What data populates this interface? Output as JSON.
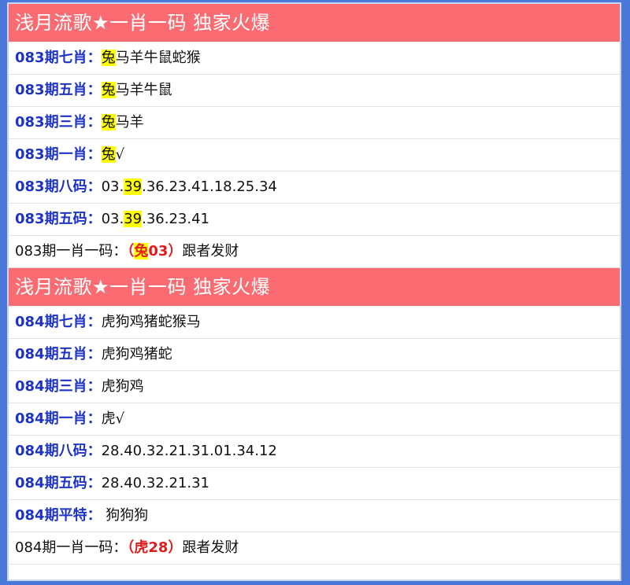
{
  "colors": {
    "header_bg": "#fa6b72",
    "label_blue": "#1d33c6",
    "highlight": "#ffff00",
    "red": "#e11b1b"
  },
  "blocks": [
    {
      "title": "浅月流歌★一肖一码 独家火爆",
      "rows": [
        {
          "label": "083期七肖：",
          "hl": "兔",
          "rest": "马羊牛鼠蛇猴"
        },
        {
          "label": "083期五肖：",
          "hl": "兔",
          "rest": "马羊牛鼠"
        },
        {
          "label": "083期三肖：",
          "hl": "兔",
          "rest": "马羊"
        },
        {
          "label": "083期一肖：",
          "hl": "兔",
          "rest": "√"
        },
        {
          "label": "083期八码：",
          "pre": "03.",
          "hl": "39",
          "rest": ".36.23.41.18.25.34"
        },
        {
          "label": "083期五码：",
          "pre": "03.",
          "hl": "39",
          "rest": ".36.23.41"
        }
      ],
      "final": {
        "label": "083期一肖一码：",
        "open": "（",
        "hl": "兔",
        "num": "03",
        "close": "）",
        "tail": "跟者发财"
      }
    },
    {
      "title": "浅月流歌★一肖一码 独家火爆",
      "rows": [
        {
          "label": "084期七肖：",
          "value": "虎狗鸡猪蛇猴马"
        },
        {
          "label": "084期五肖：",
          "value": "虎狗鸡猪蛇"
        },
        {
          "label": "084期三肖：",
          "value": "虎狗鸡"
        },
        {
          "label": "084期一肖：",
          "value": "虎√"
        },
        {
          "label": "084期八码：",
          "value": "28.40.32.21.31.01.34.12"
        },
        {
          "label": "084期五码：",
          "value": "28.40.32.21.31"
        },
        {
          "label": "084期平特：",
          "value": " 狗狗狗"
        }
      ],
      "final": {
        "label": "084期一肖一码：",
        "open": "（",
        "text": "虎28",
        "close": "）",
        "tail": "跟者发财"
      }
    }
  ]
}
